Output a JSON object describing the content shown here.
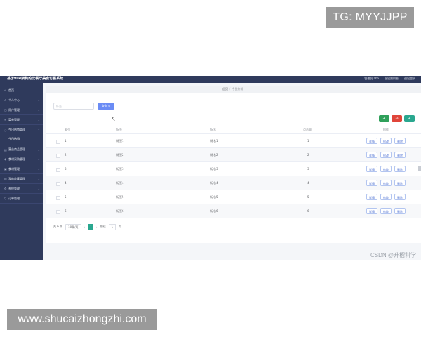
{
  "watermarks": {
    "top": "TG: MYYJJPP",
    "bottom": "www.shucaizhongzhi.com",
    "csdn": "CSDN @升榴科学"
  },
  "app": {
    "title": "基于vue架构的云餐厅美食订餐系统",
    "top_links": [
      "管理员 abo",
      "退出到前台",
      "退出登录"
    ]
  },
  "sidebar": {
    "items": [
      {
        "label": "首页",
        "icon": "home-icon"
      },
      {
        "label": "个人中心",
        "icon": "user-icon"
      },
      {
        "label": "用户管理",
        "icon": "users-icon"
      },
      {
        "label": "菜单管理",
        "icon": "menu-icon"
      },
      {
        "label": "今日热销管理",
        "icon": "fire-icon"
      },
      {
        "label": "今日热销",
        "icon": ""
      },
      {
        "label": "营业商品管理",
        "icon": "store-icon"
      },
      {
        "label": "食材采购管理",
        "icon": "cart-icon"
      },
      {
        "label": "食材管理",
        "icon": "box-icon"
      },
      {
        "label": "我的收藏管理",
        "icon": "star-icon"
      },
      {
        "label": "系统管理",
        "icon": "gear-icon"
      },
      {
        "label": "订单管理",
        "icon": "order-icon"
      }
    ]
  },
  "breadcrumb": {
    "home": "首页",
    "current": "今日热销"
  },
  "search": {
    "placeholder": "标签",
    "button": "查询 ⊙"
  },
  "actions": {
    "add": "+",
    "delete": "⊖",
    "export": "+"
  },
  "colors": {
    "sidebar": "#2f3a5c",
    "primary": "#6b8cf5",
    "success": "#2fa05a",
    "danger": "#e0453a",
    "teal": "#2aa78f"
  },
  "table": {
    "headers": [
      "索引",
      "标签",
      "标名",
      "点击量",
      "操作"
    ],
    "rows": [
      {
        "index": "1",
        "tag": "标签1",
        "name": "标名1",
        "clicks": "1"
      },
      {
        "index": "2",
        "tag": "标签2",
        "name": "标名2",
        "clicks": "2"
      },
      {
        "index": "3",
        "tag": "标签3",
        "name": "标名3",
        "clicks": "3"
      },
      {
        "index": "4",
        "tag": "标签4",
        "name": "标名4",
        "clicks": "4"
      },
      {
        "index": "5",
        "tag": "标签5",
        "name": "标名5",
        "clicks": "5"
      },
      {
        "index": "6",
        "tag": "标签6",
        "name": "标名6",
        "clicks": "6"
      }
    ],
    "row_buttons": [
      "详情",
      "修改",
      "删除"
    ]
  },
  "pager": {
    "total": "共 6 条",
    "size": "10条/页",
    "prev": "‹",
    "current": "1",
    "next": "›",
    "goto": "前往",
    "page": "1",
    "unit": "页"
  }
}
